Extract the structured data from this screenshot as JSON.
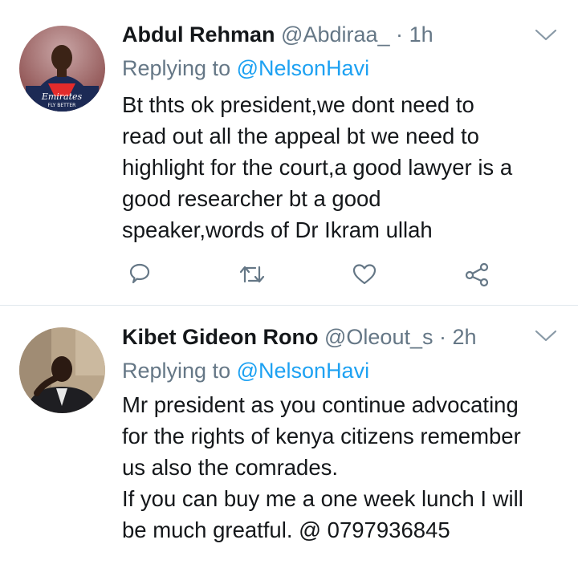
{
  "tweets": [
    {
      "name": "Abdul Rehman",
      "handle": "@Abdiraa_",
      "sep": "·",
      "time": "1h",
      "replying_prefix": "Replying to",
      "replying_to": "@NelsonHavi",
      "lines": [
        "Bt thts ok president,we dont need to",
        "read out all the appeal bt we need to",
        "highlight for the court,a good lawyer is a",
        "good researcher bt a good",
        "speaker,words of Dr Ikram ullah"
      ],
      "avatar_text": [
        "Emirates",
        "FLY BETTER"
      ],
      "icons": {
        "more": "chevron-down-icon",
        "reply": "reply-bubble-icon",
        "retweet": "retweet-icon",
        "like": "heart-icon",
        "share": "share-icon"
      }
    },
    {
      "name": "Kibet Gideon Rono",
      "handle": "@Oleout_s",
      "sep": "·",
      "time": "2h",
      "replying_prefix": "Replying to",
      "replying_to": "@NelsonHavi",
      "lines": [
        "Mr president as you continue advocating",
        "for the rights of kenya citizens remember",
        "us also the comrades.",
        "If you can buy me a one week lunch I will",
        "be much greatful. @ 0797936845"
      ],
      "icons": {
        "more": "chevron-down-icon"
      }
    }
  ],
  "colors": {
    "accent": "#1da1f2",
    "muted": "#657786",
    "text": "#14171a",
    "divider": "#e1e8ed"
  }
}
